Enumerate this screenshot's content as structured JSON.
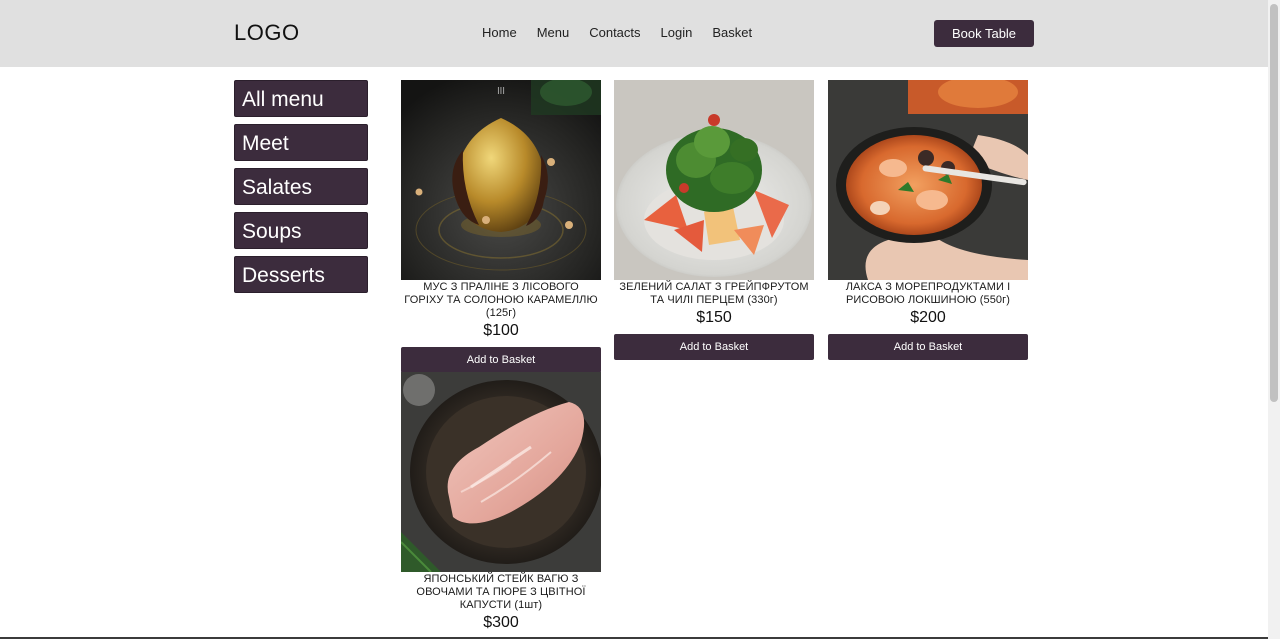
{
  "header": {
    "logo": "LOGO",
    "nav": [
      "Home",
      "Menu",
      "Contacts",
      "Login",
      "Basket"
    ],
    "book_label": "Book Table"
  },
  "sidebar": {
    "items": [
      {
        "label": "All menu"
      },
      {
        "label": "Meet"
      },
      {
        "label": "Salates"
      },
      {
        "label": "Soups"
      },
      {
        "label": "Desserts"
      }
    ]
  },
  "products": [
    {
      "name": "МУС З ПРАЛІНЕ З ЛІСОВОГО ГОРІХУ ТА СОЛОНОЮ КАРАМЕЛЛЮ (125г)",
      "price": "$100",
      "button": "Add to Basket",
      "image": "dessert-photo"
    },
    {
      "name": "ЗЕЛЕНИЙ САЛАТ З ГРЕЙПФРУТОМ ТА ЧИЛІ ПЕРЦЕМ (330г)",
      "price": "$150",
      "button": "Add to Basket",
      "image": "salad-photo"
    },
    {
      "name": "ЛАКСА З МОРЕПРОДУКТАМИ І РИСОВОЮ ЛОКШИНОЮ (550г)",
      "price": "$200",
      "button": "Add to Basket",
      "image": "soup-photo"
    },
    {
      "name": "ЯПОНСЬКИЙ СТЕЙК ВАГЮ З ОВОЧАМИ ТА ПЮРЕ З ЦВІТНОЇ КАПУСТИ (1шт)",
      "price": "$300",
      "button": "Add to Basket",
      "image": "steak-photo"
    }
  ],
  "colors": {
    "accent": "#3c2c3d",
    "header_bg": "#e0e0e0"
  }
}
